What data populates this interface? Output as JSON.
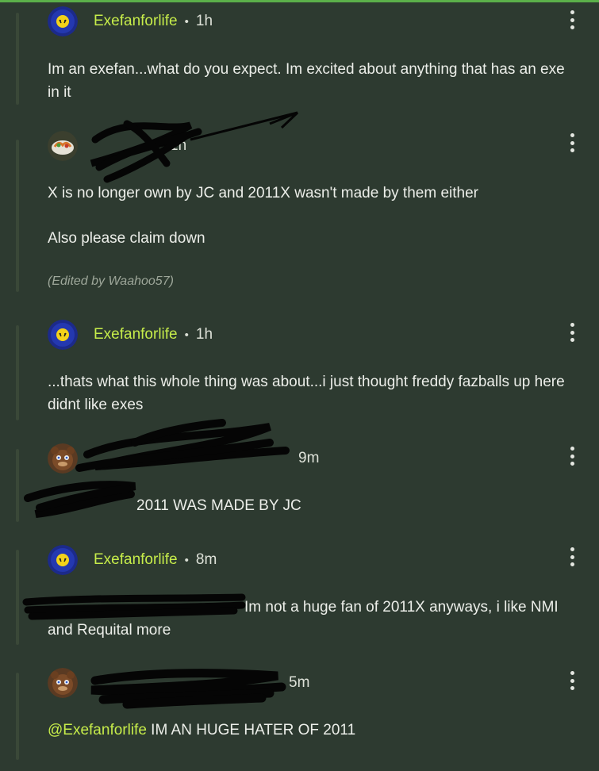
{
  "comments": [
    {
      "username": "Exefanforlife",
      "time": "1h",
      "text_1": "Im an exefan...what do you expect. Im excited about anything that has an exe in it",
      "avatar_icon": "peace-sign-avatar-icon"
    },
    {
      "time": "1h",
      "text_1": "X is no longer own by JC and 2011X wasn't made by them either",
      "text_2": "Also please claim down",
      "edited": "(Edited by Waahoo57)",
      "avatar_icon": "food-plate-avatar-icon"
    },
    {
      "username": "Exefanforlife",
      "time": "1h",
      "text_1": "...thats what this whole thing was about...i just thought freddy fazballs up here didnt like exes",
      "avatar_icon": "peace-sign-avatar-icon"
    },
    {
      "time": "9m",
      "text_1": "2011 WAS MADE BY JC",
      "avatar_icon": "freddy-avatar-icon"
    },
    {
      "username": "Exefanforlife",
      "time": "8m",
      "text_1": "Im not a huge fan of 2011X anyways, i like NMI",
      "text_2": "and Requital more",
      "avatar_icon": "peace-sign-avatar-icon"
    },
    {
      "time": "5m",
      "mention": "@Exefanforlife",
      "text_1": " IM AN HUGE HATER OF 2011",
      "avatar_icon": "freddy-avatar-icon"
    }
  ],
  "separator": "•",
  "colors": {
    "background": "#2d3a30",
    "username": "#c6ec4a",
    "accent_bar": "#5bb04a"
  }
}
